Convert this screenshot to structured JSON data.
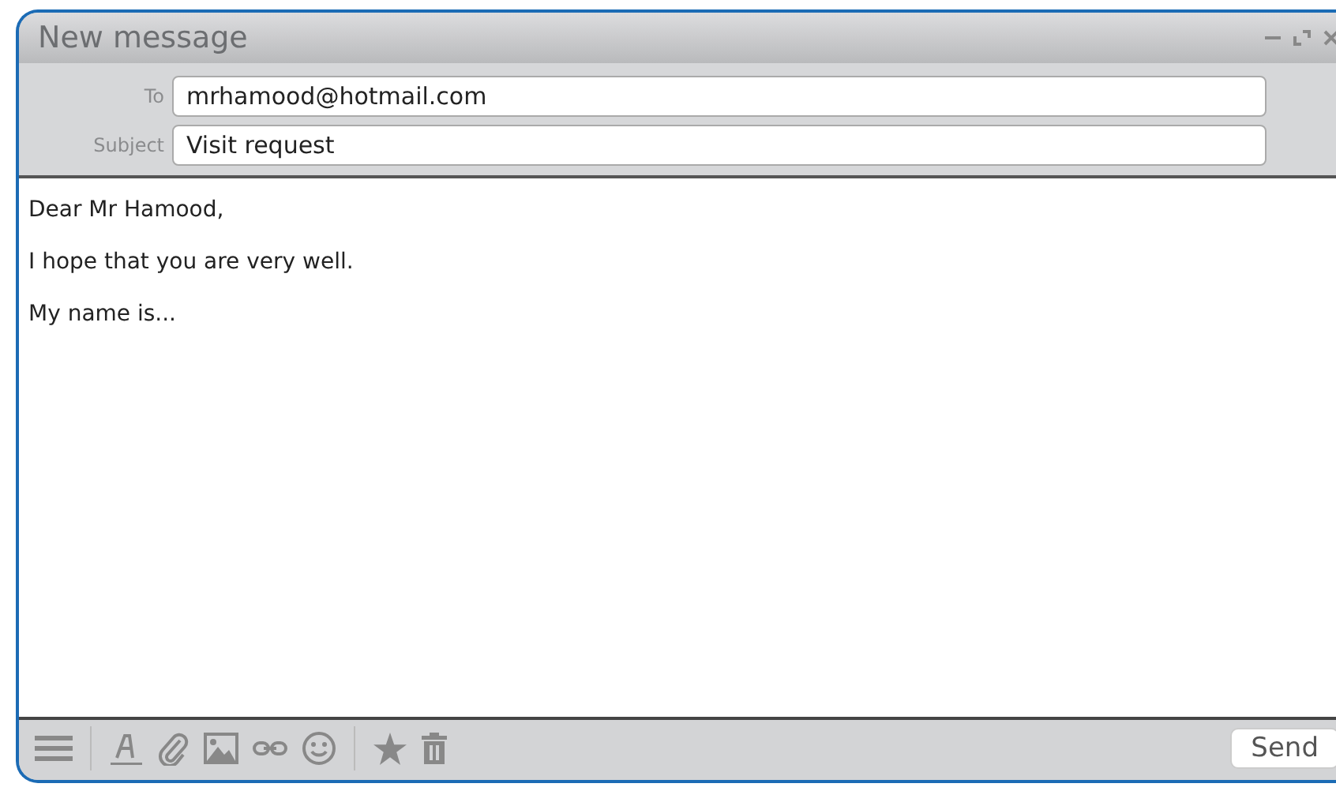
{
  "window": {
    "title": "New message"
  },
  "fields": [
    {
      "label": "To",
      "value": "mrhamood@hotmail.com"
    },
    {
      "label": "Subject",
      "value": "Visit request"
    }
  ],
  "body": [
    "Dear Mr Hamood,",
    "I hope that you are very well.",
    "My name is..."
  ],
  "send_button": "Send"
}
